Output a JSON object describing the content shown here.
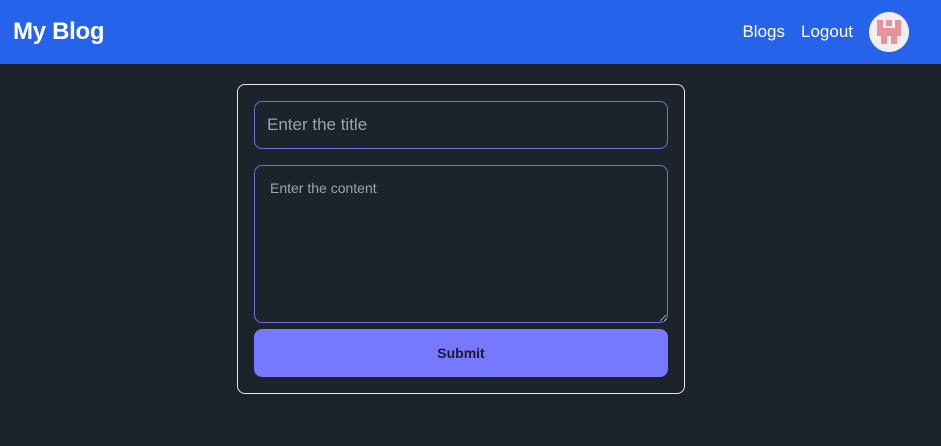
{
  "navbar": {
    "brand": "My Blog",
    "links": [
      "Blogs",
      "Logout"
    ],
    "avatar_icon": "user-avatar-icon"
  },
  "form": {
    "title_placeholder": "Enter the title",
    "title_value": "",
    "content_placeholder": "Enter the content",
    "content_value": "",
    "submit_label": "Submit"
  },
  "colors": {
    "navbar": "#2563eb",
    "background": "#1d232a",
    "input_border": "#6c6fe0",
    "button": "#7678fe",
    "avatar_glyph": "#e8929a"
  }
}
